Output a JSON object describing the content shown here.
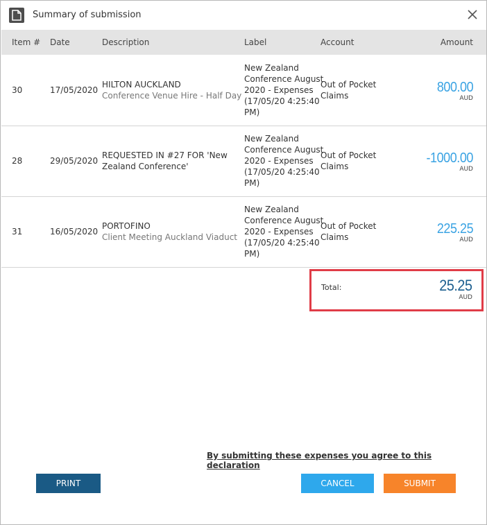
{
  "dialog": {
    "title": "Summary of submission",
    "icons": {
      "title_icon": "document-icon",
      "close_icon": "close-icon"
    }
  },
  "table": {
    "headers": [
      "Item #",
      "Date",
      "Description",
      "Label",
      "Account",
      "Amount"
    ],
    "rows": [
      {
        "item": "30",
        "date": "17/05/2020",
        "desc_main": "HILTON AUCKLAND",
        "desc_sub": "Conference Venue Hire - Half Day",
        "label": [
          "New Zealand",
          "Conference August",
          "2020 - Expenses",
          "(17/05/20 4:25:40",
          "PM)"
        ],
        "account": [
          "Out of Pocket",
          "Claims"
        ],
        "amount": "800.00",
        "currency": "AUD"
      },
      {
        "item": "28",
        "date": "29/05/2020",
        "desc_main": "REQUESTED IN #27 FOR 'New",
        "desc_sub": "Zealand Conference'",
        "label": [
          "New Zealand",
          "Conference August",
          "2020 - Expenses",
          "(17/05/20 4:25:40",
          "PM)"
        ],
        "account": [
          "Out of Pocket",
          "Claims"
        ],
        "amount": "-1000.00",
        "currency": "AUD"
      },
      {
        "item": "31",
        "date": "16/05/2020",
        "desc_main": "PORTOFINO",
        "desc_sub": "Client Meeting Auckland Viaduct",
        "label": [
          "New Zealand",
          "Conference August",
          "2020 - Expenses",
          "(17/05/20 4:25:40",
          "PM)"
        ],
        "account": [
          "Out of Pocket",
          "Claims"
        ],
        "amount": "225.25",
        "currency": "AUD"
      }
    ]
  },
  "total": {
    "label": "Total:",
    "amount": "25.25",
    "currency": "AUD"
  },
  "declaration": "By submitting these expenses you agree to this declaration",
  "buttons": {
    "print": "PRINT",
    "cancel": "CANCEL",
    "submit": "SUBMIT"
  },
  "colors": {
    "amount_blue": "#3aa3e3",
    "total_blue": "#1c5e8f",
    "print": "#1a5a85",
    "cancel": "#2ea8ec",
    "submit": "#f7842a",
    "highlight": "#e03c47"
  }
}
